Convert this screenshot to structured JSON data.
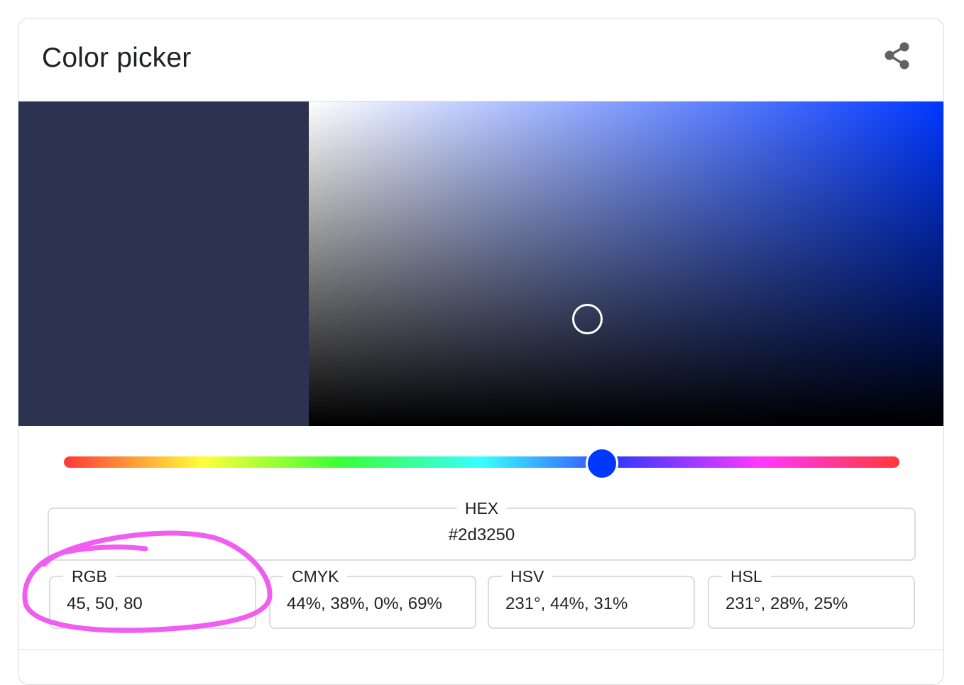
{
  "header": {
    "title": "Color picker",
    "share_icon": "share-icon"
  },
  "picker": {
    "selected_hex": "#2d3250",
    "hue_color": "#0037ff",
    "hue_degrees": 231,
    "saturation": 0.44,
    "value": 0.31
  },
  "fields": {
    "hex": {
      "label": "HEX",
      "value": "#2d3250"
    },
    "rgb": {
      "label": "RGB",
      "value": "45, 50, 80"
    },
    "cmyk": {
      "label": "CMYK",
      "value": "44%, 38%, 0%, 69%"
    },
    "hsv": {
      "label": "HSV",
      "value": "231°, 44%, 31%"
    },
    "hsl": {
      "label": "HSL",
      "value": "231°, 28%, 25%"
    }
  },
  "annotation": {
    "color": "#f05df0",
    "target": "rgb"
  }
}
